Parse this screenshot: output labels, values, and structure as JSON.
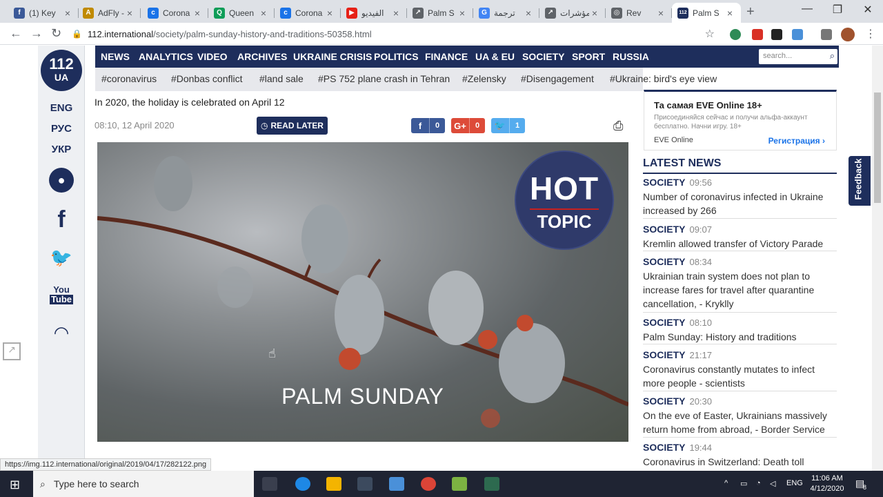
{
  "browser": {
    "tabs": [
      {
        "label": "(1) Key",
        "fav": "f",
        "favcolor": "#3b5998"
      },
      {
        "label": "AdFly -",
        "fav": "A",
        "favcolor": "#c08a00"
      },
      {
        "label": "Corona",
        "fav": "c",
        "favcolor": "#1a73e8"
      },
      {
        "label": "Queen",
        "fav": "Q",
        "favcolor": "#0f9d58"
      },
      {
        "label": "Corona",
        "fav": "c",
        "favcolor": "#1a73e8"
      },
      {
        "label": "الفيديو",
        "fav": "▶",
        "favcolor": "#e62117"
      },
      {
        "label": "Palm S",
        "fav": "↗",
        "favcolor": "#5f6368"
      },
      {
        "label": "ترجمة",
        "fav": "G",
        "favcolor": "#4285f4"
      },
      {
        "label": "مؤشرات",
        "fav": "↗",
        "favcolor": "#5f6368"
      },
      {
        "label": "Rev",
        "fav": "◎",
        "favcolor": "#5f6368"
      },
      {
        "label": "Palm S",
        "fav": "112",
        "favcolor": "#1e2e5c"
      }
    ],
    "new_tab": "+",
    "window_controls": [
      "—",
      "❐",
      "✕"
    ],
    "url_host": "112.international",
    "url_path": "/society/palm-sunday-history-and-traditions-50358.html"
  },
  "site": {
    "logo_number": "112",
    "logo_country": "UA",
    "languages": [
      "ENG",
      "РУС",
      "УКР"
    ],
    "youtube_top": "You",
    "youtube_bottom": "Tube",
    "nav": [
      "NEWS",
      "ANALYTICS",
      "VIDEO",
      "ARCHIVES",
      "UKRAINE CRISIS",
      "POLITICS",
      "FINANCE",
      "UA & EU",
      "SOCIETY",
      "SPORT",
      "RUSSIA"
    ],
    "search_placeholder": "search...",
    "tags": [
      "#coronavirus",
      "#Donbas conflict",
      "#land sale",
      "#PS 752 plane crash in Tehran",
      "#Zelensky",
      "#Disengagement",
      "#Ukraine: bird's eye view"
    ]
  },
  "article": {
    "subtitle": "In 2020, the holiday is celebrated on April 12",
    "date": "08:10, 12 April 2020",
    "read_later": "READ LATER",
    "share": [
      {
        "icon": "f",
        "count": "0",
        "color": "#3b5998"
      },
      {
        "icon": "G+",
        "count": "0",
        "color": "#dd4b39"
      },
      {
        "icon": "🐦",
        "count": "1",
        "color": "#55acee"
      }
    ],
    "hero_title": "PALM  SUNDAY",
    "hot_badge_top": "HOT",
    "hot_badge_bottom": "TOPIC"
  },
  "ad": {
    "heading": "Та самая EVE Online 18+",
    "desc": "Присоединяйся сейчас и получи альфа-аккаунт бесплатно. Начни игру. 18+",
    "brand": "EVE Online",
    "cta": "Регистрация"
  },
  "latest": {
    "heading": "LATEST NEWS",
    "items": [
      {
        "cat": "SOCIETY",
        "time": "09:56",
        "headline": "Number of coronavirus infected in Ukraine increased by 266"
      },
      {
        "cat": "SOCIETY",
        "time": "09:07",
        "headline": "Kremlin allowed transfer of Victory Parade"
      },
      {
        "cat": "SOCIETY",
        "time": "08:34",
        "headline": "Ukrainian train system does not plan to increase fares for travel after quarantine cancellation, - Kryklly"
      },
      {
        "cat": "SOCIETY",
        "time": "08:10",
        "headline": "Palm Sunday: History and traditions"
      },
      {
        "cat": "SOCIETY",
        "time": "21:17",
        "headline": "Coronavirus constantly mutates to infect more people - scientists"
      },
      {
        "cat": "SOCIETY",
        "time": "20:30",
        "headline": "On the eve of Easter, Ukrainians massively return home from abroad, - Border Service"
      },
      {
        "cat": "SOCIETY",
        "time": "19:44",
        "headline": "Coronavirus in Switzerland: Death toll"
      }
    ]
  },
  "feedback": "Feedback",
  "status_url": "https://img.112.international/original/2019/04/17/282122.png",
  "taskbar": {
    "search_placeholder": "Type here to search",
    "lang": "ENG",
    "time": "11:06 AM",
    "date": "4/12/2020",
    "notifications": "8"
  }
}
